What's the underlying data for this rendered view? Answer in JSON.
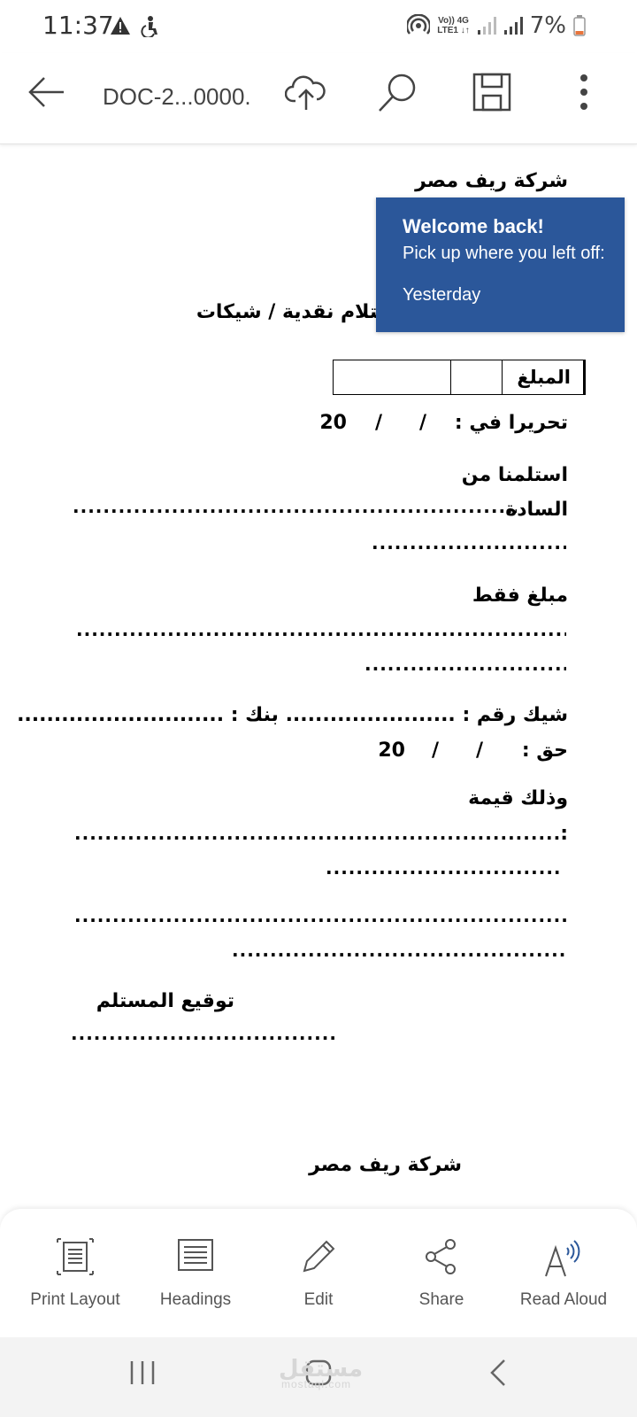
{
  "status_bar": {
    "time": "11:37",
    "network_top": "Vo)) 4G",
    "network_bottom": "LTE1 ↓↑",
    "battery": "7%",
    "icons": [
      "warning-icon",
      "accessibility-icon",
      "hotspot-icon",
      "signal-icon",
      "signal-icon",
      "battery-icon"
    ]
  },
  "app_bar": {
    "title": "DOC-2...0000.",
    "icons": [
      "back-arrow-icon",
      "cloud-upload-icon",
      "search-icon",
      "save-icon",
      "more-vertical-icon"
    ]
  },
  "document": {
    "company_header": "شركة ريف مصر",
    "receipt_title": "استلام نقدية / شيكات",
    "amount_label": "المبلغ",
    "dated": "تحريرا في :",
    "date_slash1": "/",
    "date_slash2": "/",
    "date_year": "20",
    "received_from": "استلمنا من",
    "messrs": "السادة",
    "dots_long": "...........................................................................",
    "dots_short": "...............................",
    "amount_only": "مبلغ فقط",
    "check_no": "شيك رقم : ....................... بنك : ............................",
    "due": "حق :",
    "value_of": "وذلك قيمة",
    "colon": ":",
    "signature": "توقيع المستلم",
    "dots_signature": "..........................................",
    "company_footer": "شركة ريف مصر"
  },
  "welcome_popup": {
    "title": "Welcome back!",
    "subtitle": "Pick up where you left off:",
    "item": "Yesterday",
    "color": "#2b579a"
  },
  "bottom_toolbar": {
    "items": [
      {
        "label": "Print Layout",
        "icon": "print-layout-icon"
      },
      {
        "label": "Headings",
        "icon": "headings-icon"
      },
      {
        "label": "Edit",
        "icon": "pencil-icon"
      },
      {
        "label": "Share",
        "icon": "share-icon"
      },
      {
        "label": "Read Aloud",
        "icon": "read-aloud-icon"
      }
    ]
  },
  "nav_bar": {
    "icons": [
      "recents-icon",
      "home-icon",
      "back-icon"
    ]
  },
  "watermark": {
    "text": "مستقل",
    "sub": "mostaql.com"
  }
}
